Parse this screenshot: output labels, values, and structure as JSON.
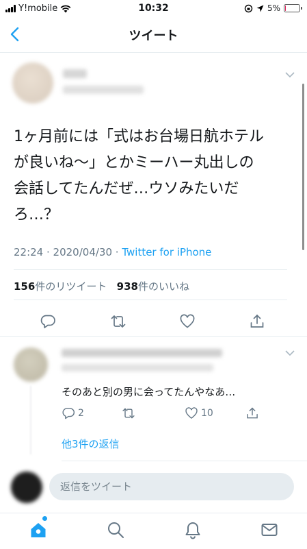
{
  "status_bar": {
    "carrier": "Y!mobile",
    "time": "10:32",
    "battery": "5%",
    "battery_level": 0.05
  },
  "nav": {
    "title": "ツイート"
  },
  "tweet": {
    "text": "1ヶ月前には「式はお台場日航ホテル\nが良いね〜」とかミーハー丸出しの\n会話してたんだぜ…ウソみたいだ\nろ…？",
    "time": "22:24",
    "date": "2020/04/30",
    "separator": " · ",
    "source": "Twitter for iPhone",
    "retweet_count": "156",
    "retweet_label": "件のリツイート",
    "like_count": "938",
    "like_label": "件のいいね"
  },
  "reply": {
    "text": "そのあと別の男に会ってたんやなあ…",
    "reply_count": "2",
    "like_count": "10",
    "more_replies": "他3件の返信"
  },
  "composer": {
    "placeholder": "返信をツイート"
  },
  "colors": {
    "accent": "#1da1f2",
    "secondary_text": "#657786",
    "divider": "#e6ecf0"
  },
  "icons": [
    "back-icon",
    "caret-down-icon",
    "reply-icon",
    "retweet-icon",
    "like-icon",
    "share-icon",
    "home-icon",
    "search-icon",
    "notifications-icon",
    "messages-icon"
  ]
}
